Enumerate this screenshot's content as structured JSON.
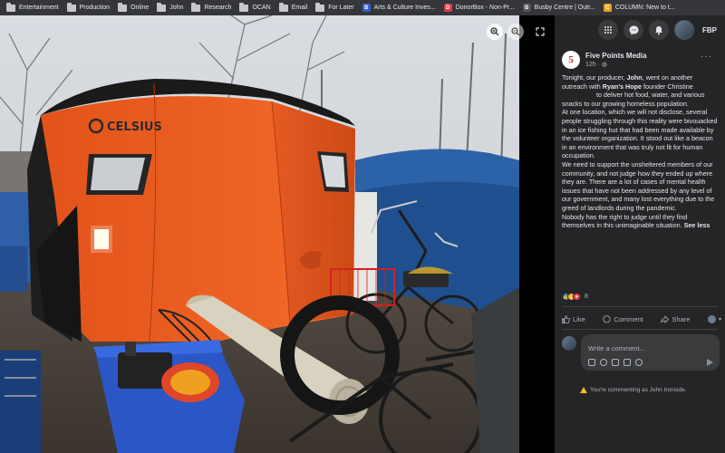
{
  "bookmarks": [
    {
      "label": "Entertainment",
      "type": "folder"
    },
    {
      "label": "Production",
      "type": "folder"
    },
    {
      "label": "Online",
      "type": "folder"
    },
    {
      "label": "John",
      "type": "folder"
    },
    {
      "label": "Research",
      "type": "folder"
    },
    {
      "label": "OCAN",
      "type": "folder"
    },
    {
      "label": "Email",
      "type": "folder"
    },
    {
      "label": "For Later",
      "type": "folder"
    },
    {
      "label": "Arts & Culture Inves...",
      "type": "site",
      "icon": "B",
      "color": "#3b5dcc"
    },
    {
      "label": "DonorBox - Non-Pr...",
      "type": "site",
      "icon": "D",
      "color": "#e23b4a"
    },
    {
      "label": "Busby Centre | Outr...",
      "type": "site",
      "icon": "B",
      "color": "#555555"
    },
    {
      "label": "COLUMN: New to t...",
      "type": "site",
      "icon": "C",
      "color": "#e8a21a"
    }
  ],
  "photo": {
    "tent_brand": "CELSIUS"
  },
  "topbar": {
    "profile_label": "FBP"
  },
  "post": {
    "page_name": "Five Points Media",
    "time": "12h · ",
    "logo_letter": "5",
    "text": {
      "p1_a": "Tonight, our producer, ",
      "p1_b": "John",
      "p1_c": ", went on another outreach with ",
      "p1_d": "Ryan's Hope",
      "p1_e": " founder Christine",
      "p1_f": "to deliver hot food, water, and various snacks to our growing homeless population.",
      "p2": "At one location, which we will not disclose, several people struggling through this reality were bivouacked in an ice fishing hut that had been made available by the volunteer organization. It stood out like a beacon in an environment that was truly not fit for human occupation.",
      "p3": "We need to support the unsheltered members of our community, and not judge how they ended up where they are. There are a lot of cases of mental health issues that have not been addressed by any level of our government, and many lost everything due to the greed of landlords during the pandemic.",
      "p4": "Nobody has the right to judge until they find themselves in this unimaginable situation. ",
      "see_less": "See less"
    },
    "reaction_count": "8",
    "actions": {
      "like": "Like",
      "comment": "Comment",
      "share": "Share"
    },
    "comment_placeholder": "Write a comment...",
    "notice": "You're commenting as John Ironside."
  },
  "colors": {
    "panel_bg": "#242526",
    "tent_orange": "#f05a1a",
    "tarp_blue": "#1f4f8f",
    "bin_blue": "#2a56c6"
  }
}
